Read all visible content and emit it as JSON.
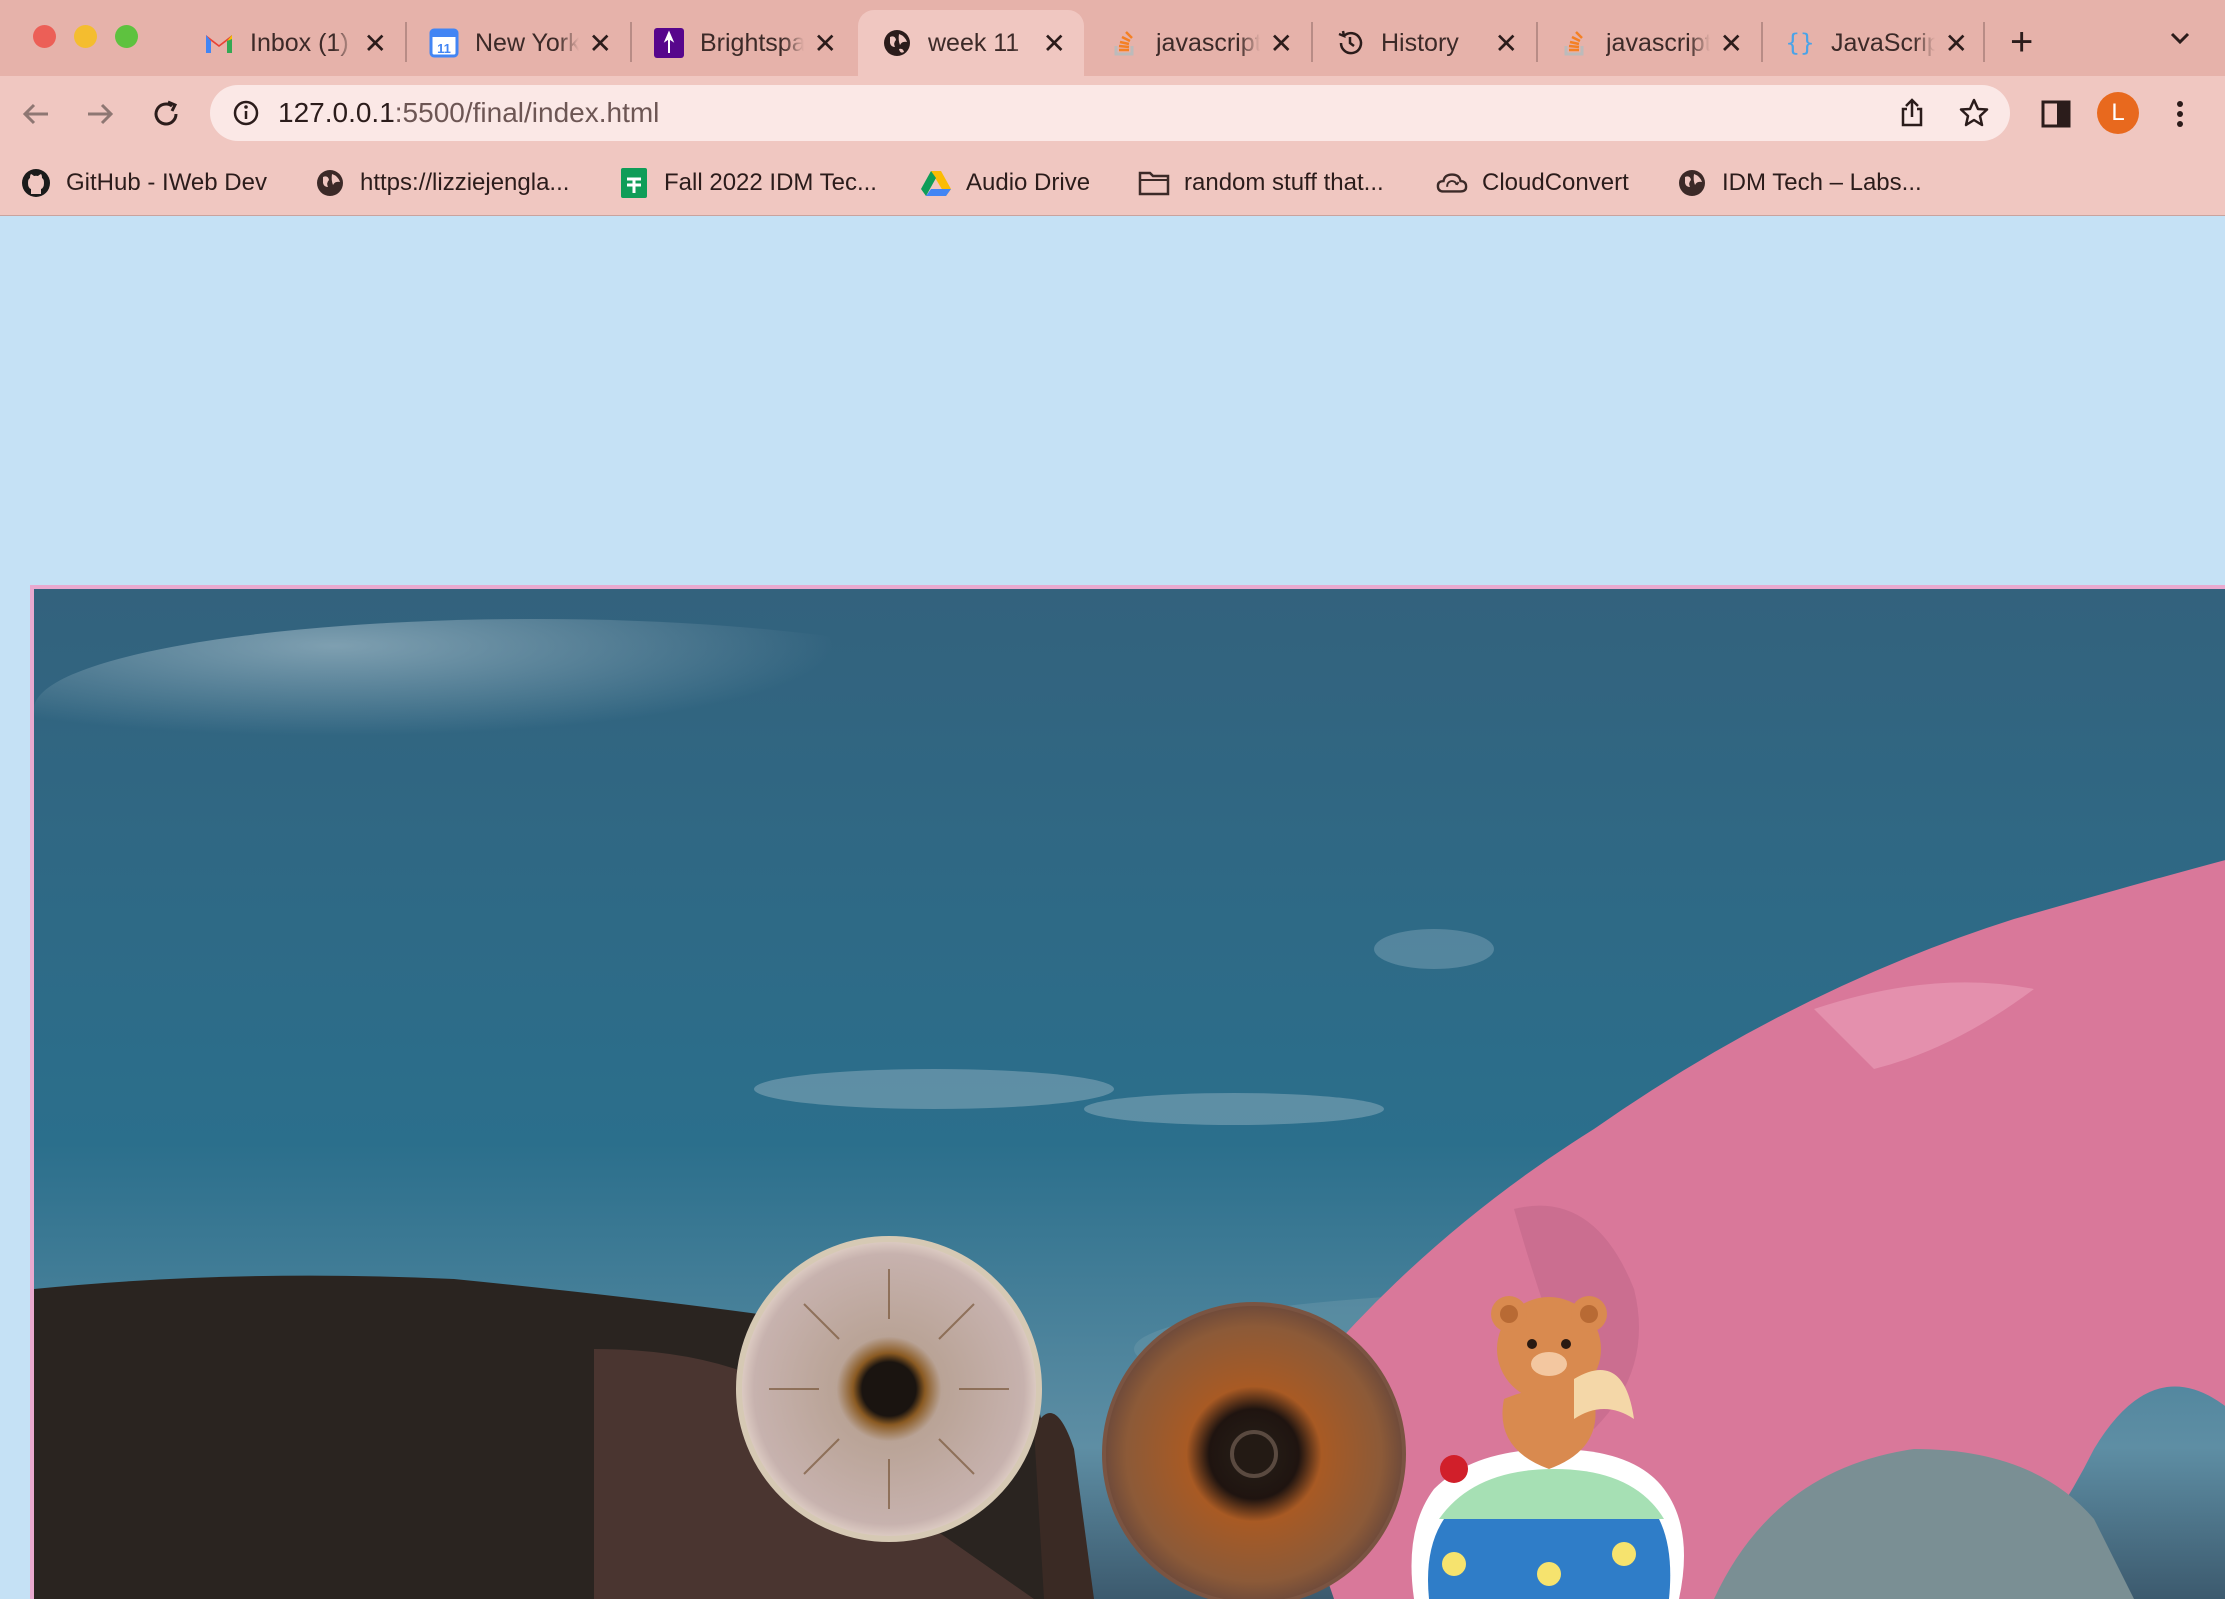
{
  "browser": {
    "tabs": [
      {
        "title": "Inbox (1)",
        "icon": "gmail-icon",
        "active": false
      },
      {
        "title": "New York",
        "icon": "calendar-icon",
        "active": false
      },
      {
        "title": "Brightspace",
        "icon": "brightspace-icon",
        "active": false
      },
      {
        "title": "week 11",
        "icon": "globe-icon",
        "active": true
      },
      {
        "title": "javascript",
        "icon": "stackoverflow-icon",
        "active": false
      },
      {
        "title": "History",
        "icon": "history-icon",
        "active": false
      },
      {
        "title": "javascript",
        "icon": "stackoverflow-icon",
        "active": false
      },
      {
        "title": "JavaScript",
        "icon": "braces-icon",
        "active": false
      }
    ],
    "tab_close_glyph": "✕",
    "new_tab_glyph": "+",
    "address": {
      "host": "127.0.0.1",
      "path": ":5500/final/index.html"
    },
    "profile_initial": "L",
    "bookmarks": [
      {
        "label": "GitHub - IWeb Dev",
        "icon": "github-icon"
      },
      {
        "label": "https://lizziejengla...",
        "icon": "globe-icon"
      },
      {
        "label": "Fall 2022 IDM Tec...",
        "icon": "sheets-icon"
      },
      {
        "label": "Audio Drive",
        "icon": "drive-icon"
      },
      {
        "label": "random stuff that...",
        "icon": "folder-icon"
      },
      {
        "label": "CloudConvert",
        "icon": "cloud-icon"
      },
      {
        "label": "IDM Tech – Labs...",
        "icon": "globe-icon"
      }
    ]
  },
  "page": {
    "background": "#c5e1f5",
    "frame_border": "#e9a9cf",
    "collage_items": [
      "photo-background",
      "eye-grey",
      "eye-brown",
      "bear-cupcake-sticker"
    ]
  }
}
